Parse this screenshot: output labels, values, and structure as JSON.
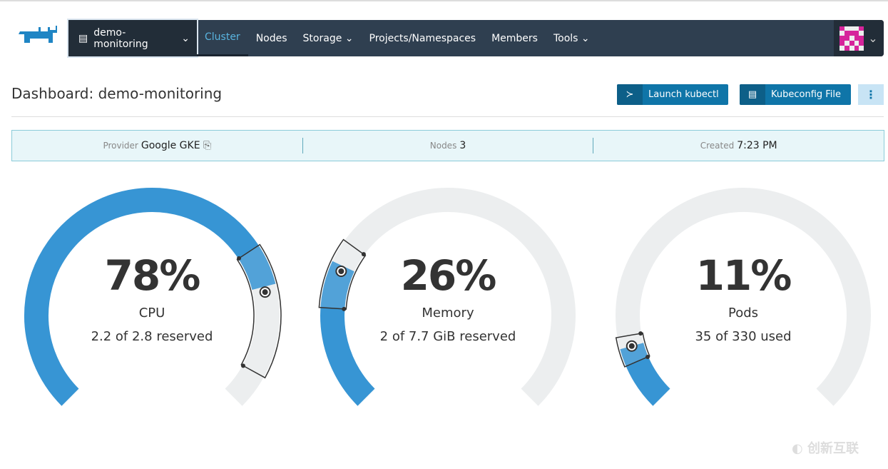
{
  "nav": {
    "cluster": "demo-monitoring",
    "items": [
      {
        "label": "Cluster",
        "active": true
      },
      {
        "label": "Nodes"
      },
      {
        "label": "Storage",
        "dropdown": true
      },
      {
        "label": "Projects/Namespaces"
      },
      {
        "label": "Members"
      },
      {
        "label": "Tools",
        "dropdown": true
      }
    ]
  },
  "page": {
    "title": "Dashboard: demo-monitoring",
    "launch_kubectl": "Launch kubectl",
    "kubeconfig": "Kubeconfig File"
  },
  "info": {
    "provider_label": "Provider",
    "provider": "Google GKE",
    "nodes_label": "Nodes",
    "nodes": "3",
    "created_label": "Created",
    "created": "7:23 PM"
  },
  "gauges": [
    {
      "pct": "78%",
      "label": "CPU",
      "sub": "2.2 of 2.8 reserved",
      "value": 0.78,
      "range": [
        0.71,
        0.94
      ],
      "marker": 0.79
    },
    {
      "pct": "26%",
      "label": "Memory",
      "sub": "2 of 7.7 GiB reserved",
      "value": 0.26,
      "range": [
        0.18,
        0.3
      ],
      "marker": 0.25
    },
    {
      "pct": "11%",
      "label": "Pods",
      "sub": "35 of 330 used",
      "value": 0.11,
      "range": [
        0.08,
        0.13
      ],
      "marker": 0.11
    }
  ],
  "colors": {
    "fill": "#3795d4",
    "track": "#eceeef",
    "nav": "#2f3f50"
  },
  "watermark": "创新互联"
}
